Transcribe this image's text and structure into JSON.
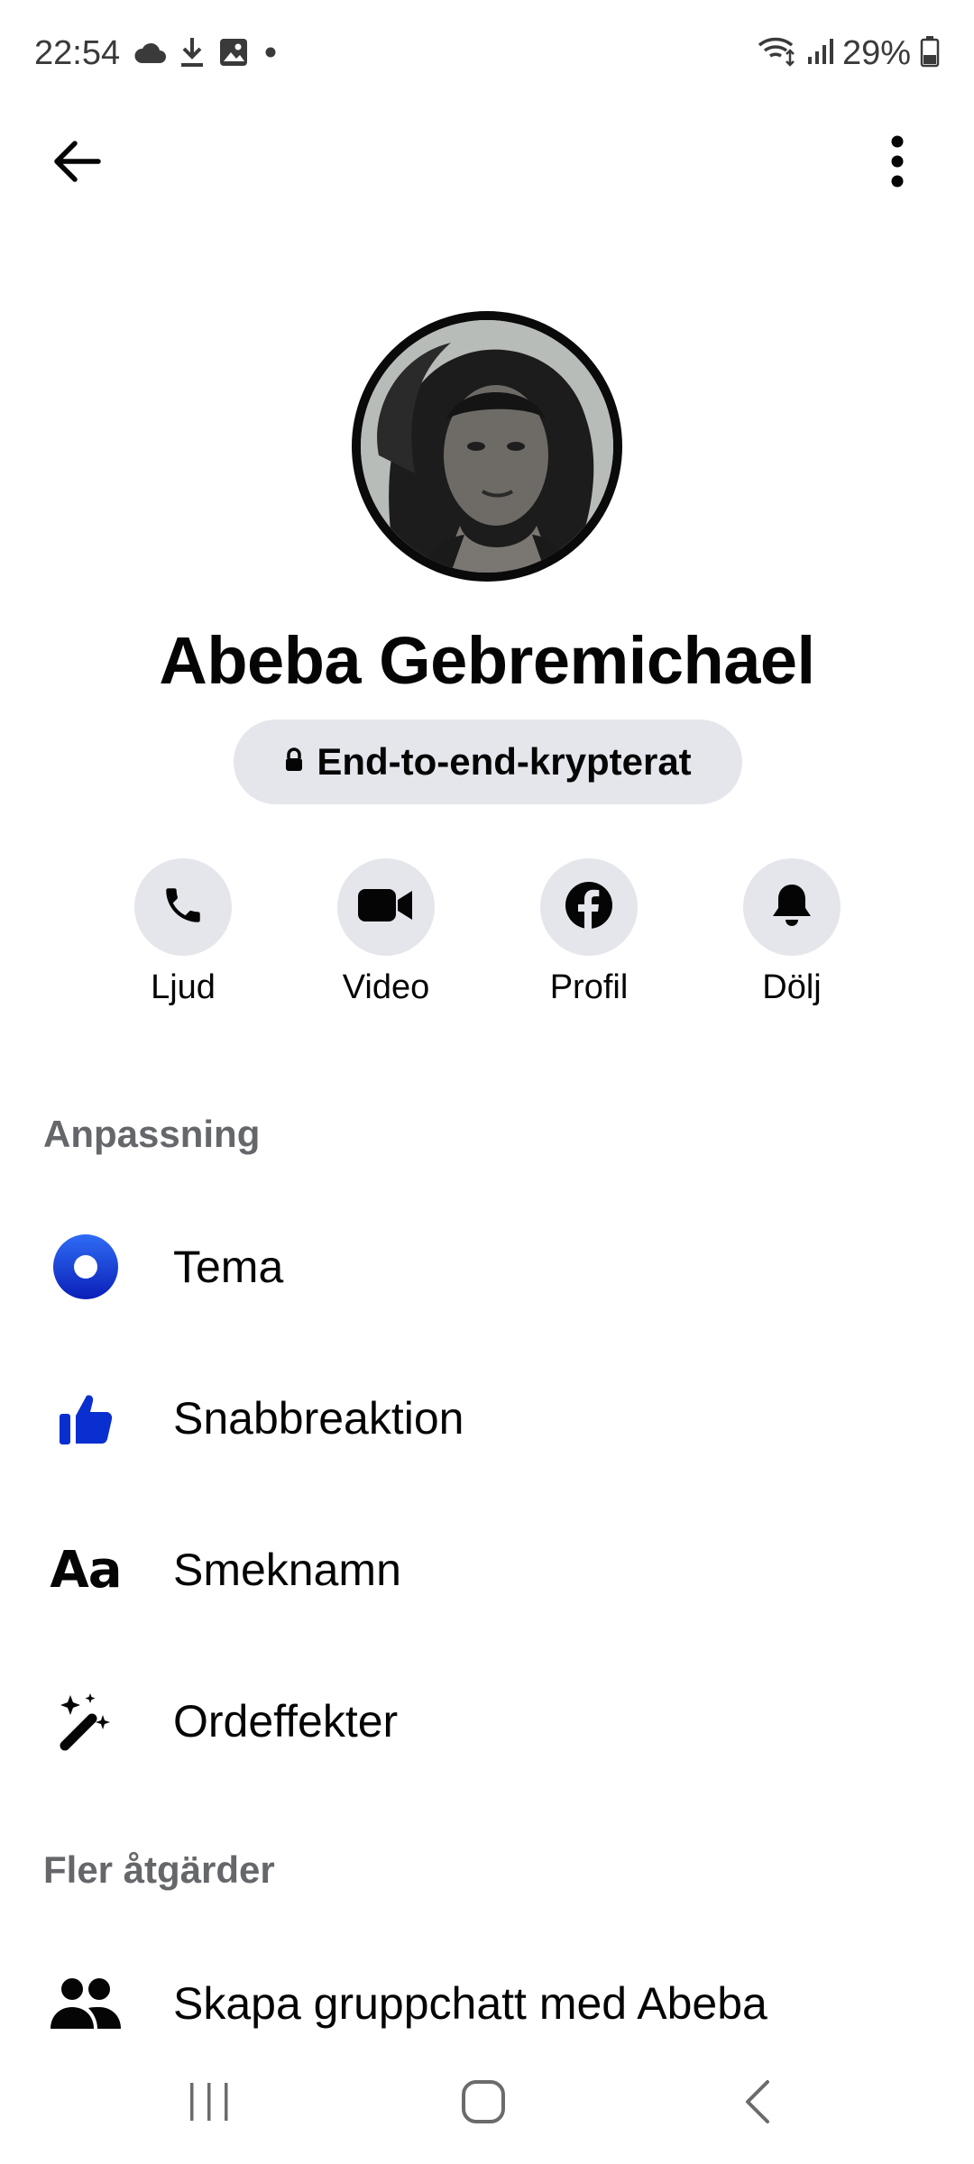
{
  "status_bar": {
    "time": "22:54",
    "battery": "29%",
    "left_icons": [
      "cloud-icon",
      "download-icon",
      "image-icon",
      "dot-icon"
    ],
    "right_icons": [
      "wifi-icon",
      "signal-icon",
      "battery-icon"
    ]
  },
  "header": {
    "back_icon": "arrow-left-icon",
    "more_icon": "more-vertical-icon"
  },
  "profile": {
    "name": "Abeba Gebremichael",
    "encryption_label": "End-to-end-krypterat"
  },
  "actions": [
    {
      "label": "Ljud",
      "icon": "phone-icon"
    },
    {
      "label": "Video",
      "icon": "video-camera-icon"
    },
    {
      "label": "Profil",
      "icon": "facebook-icon"
    },
    {
      "label": "Dölj",
      "icon": "bell-icon"
    }
  ],
  "sections": {
    "customize": {
      "title": "Anpassning",
      "items": [
        {
          "label": "Tema",
          "icon": "theme-circle-icon"
        },
        {
          "label": "Snabbreaktion",
          "icon": "thumbs-up-icon"
        },
        {
          "label": "Smeknamn",
          "icon": "text-aa-icon"
        },
        {
          "label": "Ordeffekter",
          "icon": "magic-wand-icon"
        }
      ]
    },
    "more_actions": {
      "title": "Fler åtgärder",
      "items": [
        {
          "label": "Skapa gruppchatt med Abeba",
          "icon": "people-icon"
        }
      ]
    }
  },
  "colors": {
    "accent_blue": "#0a3cd6",
    "button_gray": "#e4e6eb",
    "section_gray": "#65676b"
  }
}
